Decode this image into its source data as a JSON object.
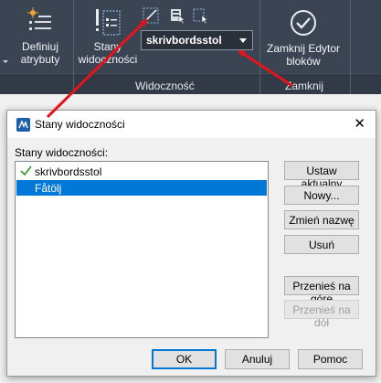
{
  "ribbon": {
    "define_attributes_label": "Definiuj\natrybuty",
    "visibility_states_label": "Stany\nwidoczności",
    "visibility_combo_value": "skrivbordsstol",
    "close_editor_label": "Zamknij Edytor\nbloków",
    "group_visibility": "Widoczność",
    "group_close": "Zamknij"
  },
  "dialog": {
    "title": "Stany widoczności",
    "list_label": "Stany widoczności:",
    "states": [
      "skrivbordsstol",
      "Fåtölj"
    ],
    "current_state": "skrivbordsstol",
    "selected_state": "Fåtölj",
    "buttons": {
      "set_current": "Ustaw aktualny",
      "new": "Nowy...",
      "rename": "Zmień nazwę",
      "delete": "Usuń",
      "move_up": "Przenieś na górę",
      "move_down": "Przenieś na dół"
    },
    "footer": {
      "ok": "OK",
      "cancel": "Anuluj",
      "help": "Pomoc"
    }
  },
  "colors": {
    "ribbon_bg": "#3b4453",
    "selection": "#0078d7",
    "annotation_arrow": "#e3141b",
    "check": "#3c9a3c"
  }
}
